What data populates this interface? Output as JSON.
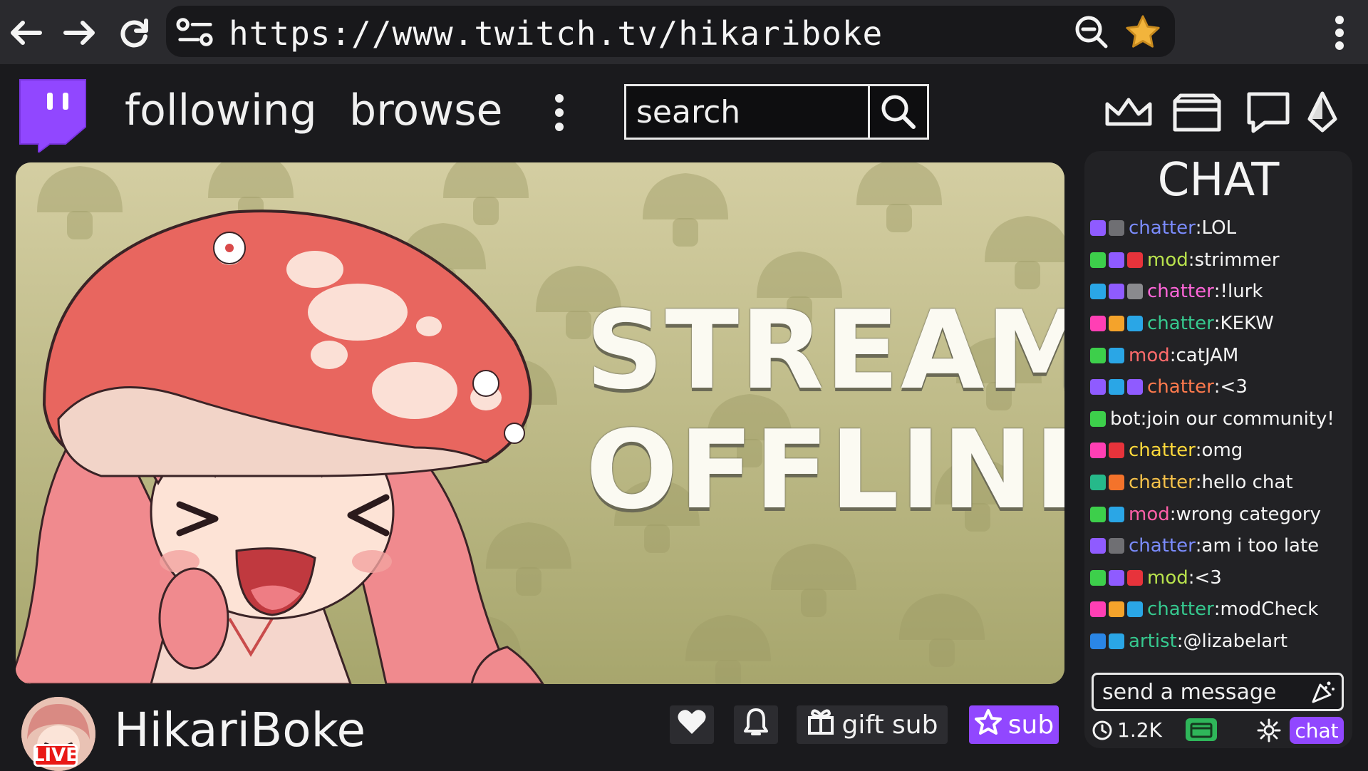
{
  "browser": {
    "url": "https://www.twitch.tv/hikariboke",
    "icons": [
      "back-arrow-icon",
      "forward-arrow-icon",
      "reload-icon",
      "site-settings-icon",
      "zoom-out-icon",
      "star-icon",
      "kebab-menu-icon"
    ]
  },
  "header": {
    "following_label": "following",
    "browse_label": "browse",
    "search_placeholder": "search",
    "icons": [
      "twitch-logo",
      "more-dots-icon",
      "search-icon",
      "crown-icon",
      "inbox-icon",
      "whisper-icon",
      "bits-icon"
    ]
  },
  "player": {
    "offline_line1": "STREAM",
    "offline_line2": "OFFLINE"
  },
  "channel": {
    "name": "HikariBoke",
    "live_label": "LIVE",
    "gift_sub_label": "gift sub",
    "sub_label": "sub",
    "icons": [
      "heart-icon",
      "bell-icon",
      "gift-icon",
      "sub-star-icon"
    ]
  },
  "chat": {
    "title": "CHAT",
    "messages": [
      {
        "name": "chatter",
        "text": "LOL",
        "color": "#7b8cff",
        "badges": [
          "#8f5bff",
          "#6f6f73"
        ]
      },
      {
        "name": "mod",
        "text": "strimmer",
        "color": "#b9e34d",
        "badges": [
          "#3dcf4b",
          "#8f5bff",
          "#e7333b"
        ]
      },
      {
        "name": "chatter",
        "text": "!lurk",
        "color": "#ff66d9",
        "badges": [
          "#2aa6e6",
          "#8f5bff",
          "#8a8a8e"
        ]
      },
      {
        "name": "chatter",
        "text": "KEKW",
        "color": "#36c98f",
        "badges": [
          "#ff3fb4",
          "#f4a32b",
          "#2aa6e6"
        ]
      },
      {
        "name": "mod",
        "text": "catJAM",
        "color": "#ff6b6b",
        "badges": [
          "#3dcf4b",
          "#2aa6e6"
        ]
      },
      {
        "name": "chatter",
        "text": "<3",
        "color": "#ff7a4d",
        "badges": [
          "#8f5bff",
          "#2aa6e6",
          "#8f5bff"
        ]
      },
      {
        "name": "bot",
        "text": "join our community!",
        "color": "#f4f4f4",
        "badges": [
          "#3dcf4b"
        ]
      },
      {
        "name": "chatter",
        "text": "omg",
        "color": "#ffd93b",
        "badges": [
          "#ff3fb4",
          "#e7333b"
        ]
      },
      {
        "name": "chatter",
        "text": "hello chat",
        "color": "#f6c24a",
        "badges": [
          "#26b98a",
          "#f4732b"
        ]
      },
      {
        "name": "mod",
        "text": "wrong category",
        "color": "#ff5fa8",
        "badges": [
          "#3dcf4b",
          "#2aa6e6"
        ]
      },
      {
        "name": "chatter",
        "text": "am i too late",
        "color": "#7b8cff",
        "badges": [
          "#8f5bff",
          "#6f6f73"
        ]
      },
      {
        "name": "mod",
        "text": "<3",
        "color": "#b9e34d",
        "badges": [
          "#3dcf4b",
          "#8f5bff",
          "#e7333b"
        ]
      },
      {
        "name": "chatter",
        "text": "modCheck",
        "color": "#36c98f",
        "badges": [
          "#ff3fb4",
          "#f4a32b",
          "#2aa6e6"
        ]
      },
      {
        "name": "artist",
        "text": "@lizabelart",
        "color": "#36c98f",
        "badges": [
          "#2a86e6",
          "#2aa6e6"
        ]
      }
    ],
    "input_placeholder": "send a message",
    "viewer_count": "1.2K",
    "chat_button_label": "chat",
    "icons": [
      "emote-picker-icon",
      "viewers-icon",
      "channel-points-icon",
      "settings-gear-icon"
    ]
  },
  "colors": {
    "accent": "#9147ff",
    "live_red": "#e91916",
    "player_bg": "#cbc596",
    "page_bg": "#1a1a1d"
  }
}
